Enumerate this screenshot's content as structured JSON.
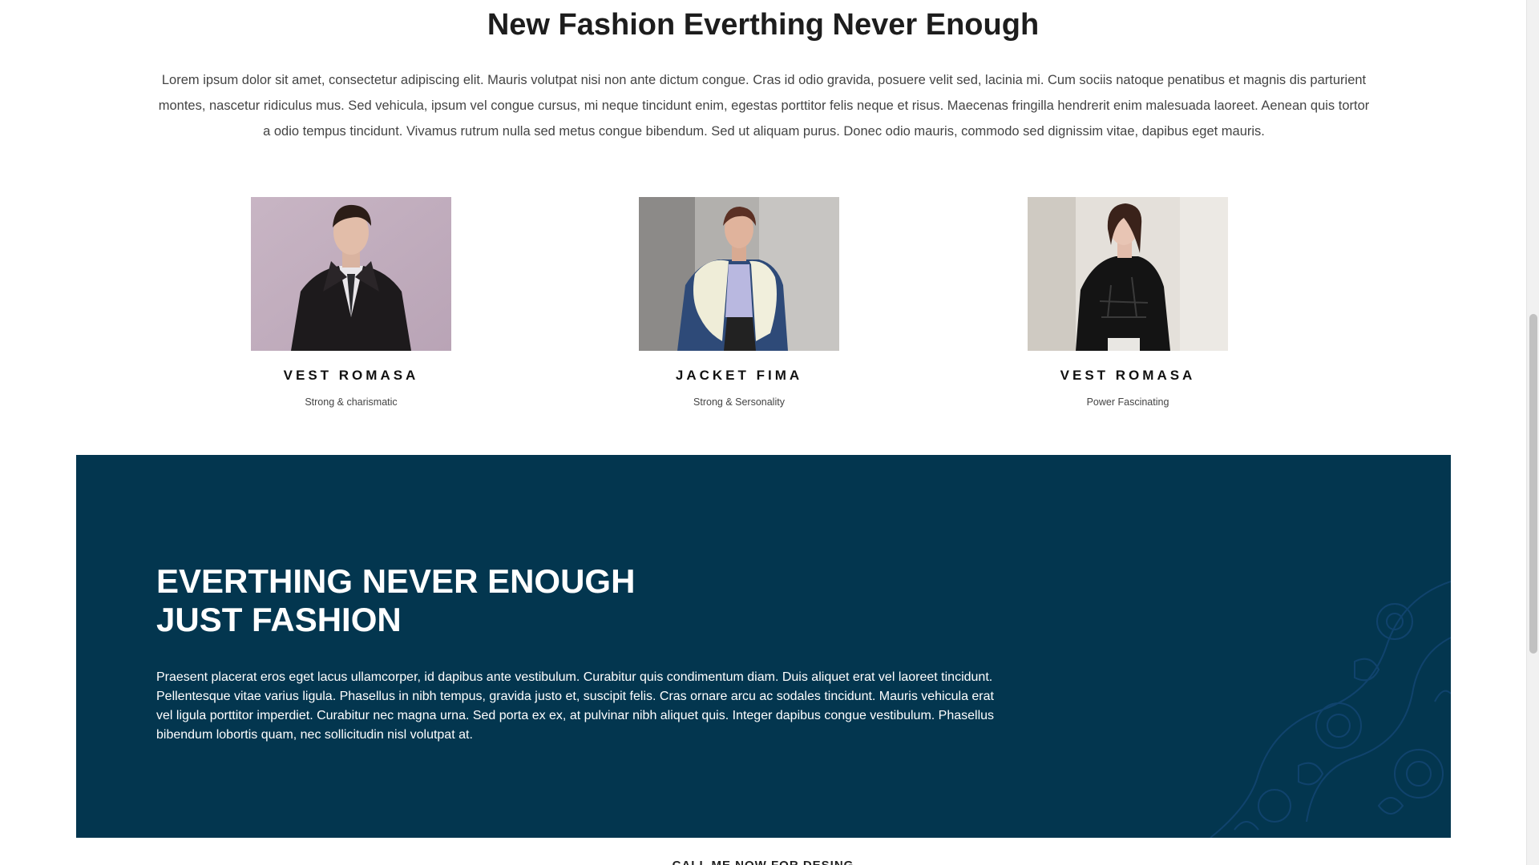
{
  "intro": {
    "title": "New Fashion Everthing Never Enough",
    "text": "Lorem ipsum dolor sit amet, consectetur adipiscing elit. Mauris volutpat nisi non ante dictum congue. Cras id odio gravida, posuere velit sed, lacinia mi. Cum sociis natoque penatibus et magnis dis parturient montes, nascetur ridiculus mus. Sed vehicula, ipsum vel congue cursus, mi neque tincidunt enim, egestas porttitor felis neque et risus. Maecenas fringilla hendrerit enim malesuada laoreet. Aenean quis tortor a odio tempus tincidunt. Vivamus rutrum nulla sed metus congue bibendum. Sed ut aliquam purus. Donec odio mauris, commodo sed dignissim vitae, dapibus eget mauris."
  },
  "products": [
    {
      "name": "VEST ROMASA",
      "subtitle": "Strong & charismatic"
    },
    {
      "name": "JACKET FIMA",
      "subtitle": "Strong & Sersonality"
    },
    {
      "name": "VEST ROMASA",
      "subtitle": "Power Fascinating"
    }
  ],
  "banner": {
    "title_line1": "EVERTHING NEVER ENOUGH",
    "title_line2": "JUST FASHION",
    "text": "Praesent placerat eros eget lacus ullamcorper, id dapibus ante vestibulum. Curabitur quis condimentum diam. Duis aliquet erat vel laoreet tincidunt. Pellentesque vitae varius ligula. Phasellus in nibh tempus, gravida justo et, suscipit felis. Cras ornare arcu ac sodales tincidunt. Mauris vehicula erat vel ligula porttitor imperdiet. Curabitur nec magna urna. Sed porta ex ex, at pulvinar nibh aliquet quis. Integer dapibus congue vestibulum. Phasellus bibendum lobortis quam, nec sollicitudin nisl volutpat at."
  },
  "cta": {
    "text": "CALL ME NOW FOR DESING"
  },
  "colors": {
    "banner_bg": "#03364f",
    "pattern": "#1c4f86"
  }
}
